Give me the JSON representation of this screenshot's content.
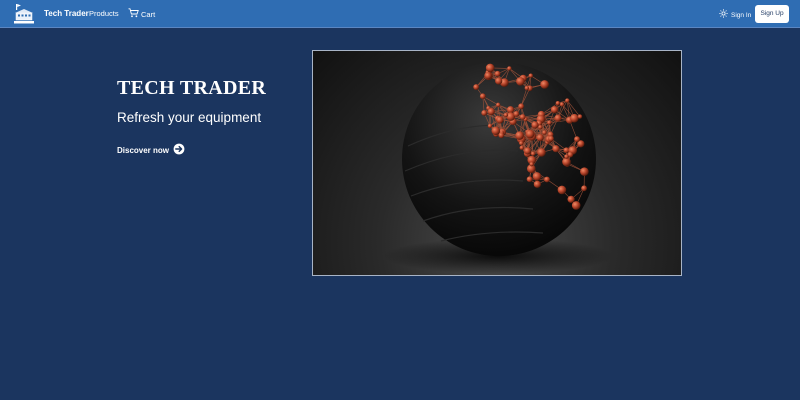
{
  "navbar": {
    "brand_name": "Tech Trader",
    "logo_icon": "store-logo-icon",
    "products_label": "Products",
    "cart_label": "Cart",
    "cart_icon": "cart-icon",
    "signin_label": "Sign In",
    "signin_icon": "user-icon",
    "signup_label": "Sign Up"
  },
  "hero": {
    "title": "TECH TRADER",
    "subtitle": "Refresh your equipment",
    "link_label": "Discover now",
    "link_icon": "arrow-right-circle-icon",
    "image_subject": "dark-sphere-with-copper-network"
  },
  "colors": {
    "navbar_bg": "#2f6db3",
    "page_bg": "#1b355f",
    "text": "#ffffff",
    "signup_text": "#1b355f",
    "sphere_node": "#b8452b"
  }
}
